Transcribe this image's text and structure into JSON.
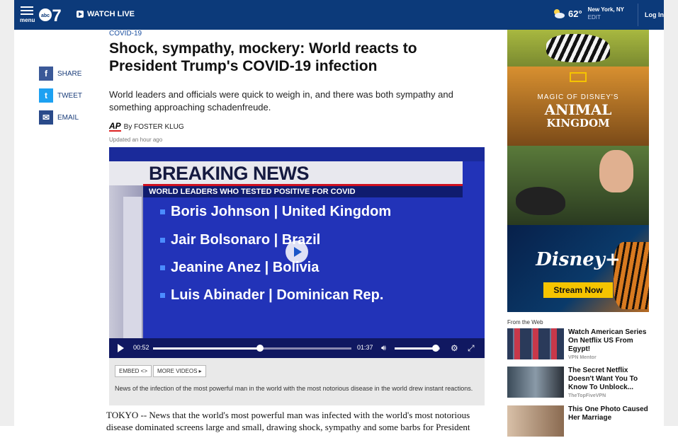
{
  "header": {
    "menu_label": "menu",
    "logo_text": "abc7",
    "watch_live": "WATCH LIVE",
    "weather": {
      "temp": "62°",
      "city": "New York, NY",
      "edit": "EDIT"
    },
    "login": "Log In"
  },
  "share": [
    {
      "icon": "facebook-icon",
      "label": "SHARE",
      "glyph": "f",
      "color": "#3b5998"
    },
    {
      "icon": "twitter-icon",
      "label": "TWEET",
      "glyph": "t",
      "color": "#1da1f2"
    },
    {
      "icon": "email-icon",
      "label": "EMAIL",
      "glyph": "✉",
      "color": "#2a4a8a"
    }
  ],
  "article": {
    "kicker": "COVID-19",
    "headline": "Shock, sympathy, mockery: World reacts to President Trump's COVID-19 infection",
    "dek": "World leaders and officials were quick to weigh in, and there was both sympathy and something approaching schadenfreude.",
    "ap_logo": "AP",
    "byline": "By FOSTER KLUG",
    "updated": "Updated an hour ago",
    "body_start": "TOKYO -- News that the world's most powerful man was infected with the world's most notorious disease dominated screens large and small, drawing shock, sympathy and some barbs for President"
  },
  "video": {
    "banner": "BREAKING NEWS",
    "subtitle": "WORLD LEADERS WHO TESTED POSITIVE FOR COVID",
    "items": [
      "Boris Johnson | United Kingdom",
      "Jair Bolsonaro | Brazil",
      "Jeanine Anez | Bolivia",
      "Luis Abinader | Dominican Rep."
    ],
    "current_time": "00:52",
    "duration": "01:37",
    "progress": 0.54,
    "volume": 0.9,
    "embed_label": "EMBED <>",
    "more_label": "MORE VIDEOS ▸",
    "caption": "News of the infection of the most powerful man in the world with the most notorious disease in the world drew instant reactions."
  },
  "ad": {
    "magic": "MAGIC OF DISNEY'S",
    "animal": "ANIMAL",
    "kingdom": "KINGDOM",
    "disney_plus": "Disney+",
    "stream_now": "Stream Now"
  },
  "recommendations": {
    "heading": "From the Web",
    "items": [
      {
        "title": "Watch American Series On Netflix US From Egypt!",
        "source": "VPN Mentor",
        "thumb_color": "#3a4a6a"
      },
      {
        "title": "The Secret Netflix Doesn't Want You To Know To Unblock...",
        "source": "TheTopFiveVPN",
        "thumb_color": "#4a5a6a"
      },
      {
        "title": "This One Photo Caused Her Marriage",
        "source": "",
        "thumb_color": "#b89a7a"
      }
    ]
  },
  "colors": {
    "brand_blue": "#0c3a7a",
    "ad_yellow": "#f5c400"
  }
}
